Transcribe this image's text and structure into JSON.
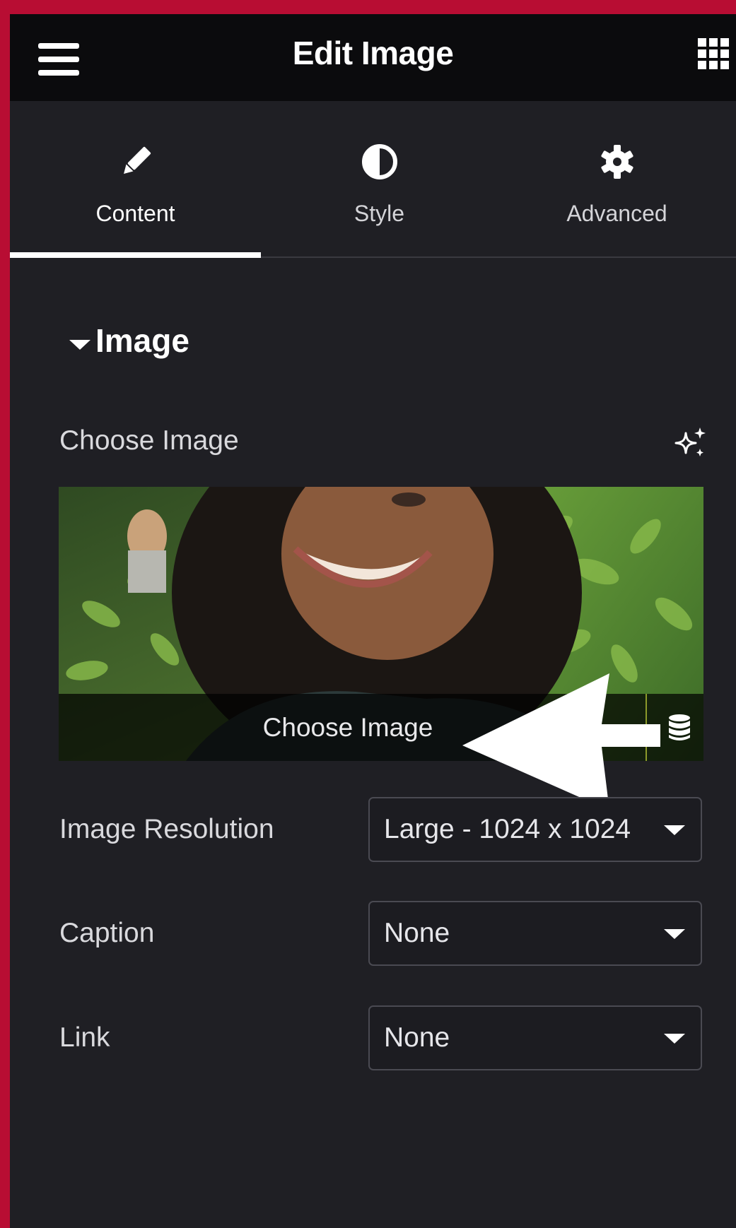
{
  "header": {
    "title": "Edit Image",
    "menu_icon": "hamburger-menu-icon",
    "apps_icon": "grid-apps-icon"
  },
  "tabs": [
    {
      "label": "Content",
      "icon": "pencil-icon",
      "active": true
    },
    {
      "label": "Style",
      "icon": "contrast-half-circle-icon",
      "active": false
    },
    {
      "label": "Advanced",
      "icon": "gear-icon",
      "active": false
    }
  ],
  "section": {
    "title": "Image",
    "expanded": true
  },
  "choose_image": {
    "label": "Choose Image",
    "button_label": "Choose Image",
    "ai_icon": "sparkle-ai-icon",
    "dynamic_icon": "database-icon"
  },
  "fields": {
    "resolution": {
      "label": "Image Resolution",
      "value": "Large - 1024 x 1024"
    },
    "caption": {
      "label": "Caption",
      "value": "None"
    },
    "link": {
      "label": "Link",
      "value": "None"
    }
  },
  "colors": {
    "frame": "#b80d33",
    "panel_bg": "#1f1f24",
    "header_bg": "#0b0b0d",
    "text": "#ffffff"
  }
}
